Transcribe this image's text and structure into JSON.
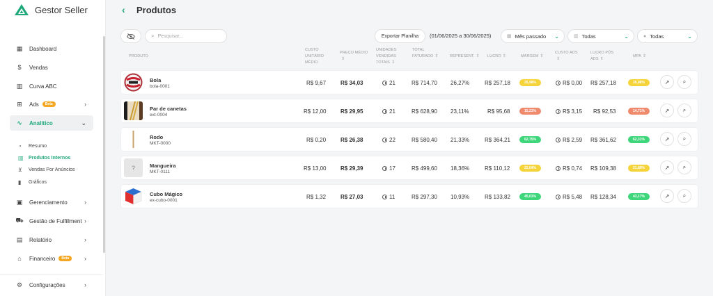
{
  "app": {
    "title": "Gestor Seller",
    "accent": "#1fa87a"
  },
  "sidebar": {
    "items": [
      {
        "label": "Dashboard",
        "icon": "dashboard-icon"
      },
      {
        "label": "Vendas",
        "icon": "dollar-icon"
      },
      {
        "label": "Curva ABC",
        "icon": "building-icon"
      },
      {
        "label": "Ads",
        "icon": "ads-icon",
        "badge": "Beta"
      },
      {
        "label": "Analítico",
        "icon": "pulse-icon"
      },
      {
        "label": "Gerenciamento",
        "icon": "box-icon"
      },
      {
        "label": "Gestão de Fulfillment",
        "icon": "truck-icon"
      },
      {
        "label": "Relatório",
        "icon": "clipboard-icon"
      },
      {
        "label": "Financeiro",
        "icon": "bank-icon",
        "badge": "Beta"
      },
      {
        "label": "Configurações",
        "icon": "gear-icon"
      }
    ],
    "subitems": [
      {
        "label": "Resumo"
      },
      {
        "label": "Produtos Internos"
      },
      {
        "label": "Vendas Por Anúncios"
      },
      {
        "label": "Gráficos"
      }
    ]
  },
  "header": {
    "title": "Produtos"
  },
  "toolbar": {
    "search_placeholder": "Pesquisar...",
    "export_label": "Exportar Planilha",
    "date_range": "(01/06/2025 a 30/06/2025)",
    "period_value": "Mês passado",
    "filter1_value": "Todas",
    "filter2_value": "Todas"
  },
  "table": {
    "headers": {
      "produto": "PRODUTO",
      "custo": "CUSTO UNITÁRIO MÉDIO",
      "preco": "PREÇO MÉDIO",
      "unidades": "UNIDADES VENDIDAS TOTAIS",
      "total": "TOTAL FATURADO",
      "represent": "REPRESENT.",
      "lucro": "LUCRO",
      "margem": "MARGEM",
      "custo_ads": "CUSTO ADS",
      "lucro_pos": "LUCRO PÓS ADS",
      "mpa": "MPA"
    },
    "rows": [
      {
        "name": "Bola",
        "sku": "bola-0001",
        "custo": "R$ 9,67",
        "preco": "R$ 34,03",
        "unidades": "21",
        "total": "R$ 714,70",
        "represent": "26,27%",
        "lucro": "R$ 257,18",
        "margem": "35,98%",
        "margem_color": "#f5d33b",
        "custo_ads": "R$ 0,00",
        "lucro_pos": "R$ 257,18",
        "mpa": "35,98%",
        "mpa_color": "#f5d33b"
      },
      {
        "name": "Par de canetas",
        "sku": "ext-0004",
        "custo": "R$ 12,00",
        "preco": "R$ 29,95",
        "unidades": "21",
        "total": "R$ 628,90",
        "represent": "23,11%",
        "lucro": "R$ 95,68",
        "margem": "15,21%",
        "margem_color": "#f08a6c",
        "custo_ads": "R$ 3,15",
        "lucro_pos": "R$ 92,53",
        "mpa": "14,71%",
        "mpa_color": "#f08a6c"
      },
      {
        "name": "Rodo",
        "sku": "MKT-0000",
        "custo": "R$ 0,20",
        "preco": "R$ 26,38",
        "unidades": "22",
        "total": "R$ 580,40",
        "represent": "21,33%",
        "lucro": "R$ 364,21",
        "margem": "62,75%",
        "margem_color": "#3ed67a",
        "custo_ads": "R$ 2,59",
        "lucro_pos": "R$ 361,62",
        "mpa": "62,31%",
        "mpa_color": "#3ed67a"
      },
      {
        "name": "Mangueira",
        "sku": "MKT-0111",
        "custo": "R$ 13,00",
        "preco": "R$ 29,39",
        "unidades": "17",
        "total": "R$ 499,60",
        "represent": "18,36%",
        "lucro": "R$ 110,12",
        "margem": "22,04%",
        "margem_color": "#f5d33b",
        "custo_ads": "R$ 0,74",
        "lucro_pos": "R$ 109,38",
        "mpa": "21,89%",
        "mpa_color": "#f5d33b"
      },
      {
        "name": "Cubo Mágico",
        "sku": "ex-cubo-0001",
        "custo": "R$ 1,32",
        "preco": "R$ 27,03",
        "unidades": "11",
        "total": "R$ 297,30",
        "represent": "10,93%",
        "lucro": "R$ 133,82",
        "margem": "45,01%",
        "margem_color": "#3ed67a",
        "custo_ads": "R$ 5,48",
        "lucro_pos": "R$ 128,34",
        "mpa": "43,17%",
        "mpa_color": "#3ed67a"
      }
    ]
  }
}
